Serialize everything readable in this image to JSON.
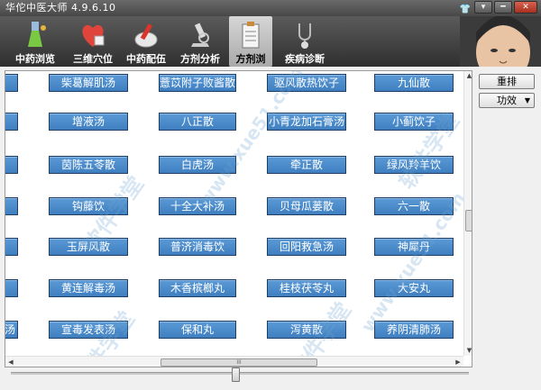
{
  "app": {
    "title": "华佗中医大师 4.9.6.10"
  },
  "window_buttons": {
    "menu": "▾",
    "minimize": "━",
    "close": "✕",
    "skin": "👕"
  },
  "toolbar": {
    "tabs": [
      {
        "label": "中药浏览",
        "icon": "flask-icon"
      },
      {
        "label": "三维穴位",
        "icon": "heart-icon"
      },
      {
        "label": "中药配伍",
        "icon": "mortar-icon"
      },
      {
        "label": "方剂分析",
        "icon": "microscope-icon"
      },
      {
        "label": "方剂浏",
        "icon": "clipboard-icon"
      },
      {
        "label": "疾病诊断",
        "icon": "stethoscope-icon"
      }
    ],
    "active_tab": "方剂浏"
  },
  "grid": {
    "rows": [
      [
        "柴葛解肌汤",
        "薏苡附子败酱散",
        "驱风散热饮子",
        "九仙散"
      ],
      [
        "增液汤",
        "八正散",
        "小青龙加石膏汤",
        "小蓟饮子"
      ],
      [
        "茵陈五苓散",
        "白虎汤",
        "牵正散",
        "绿风羚羊饮"
      ],
      [
        "钩藤饮",
        "十全大补汤",
        "贝母瓜蒌散",
        "六一散"
      ],
      [
        "玉屏风散",
        "普济消毒饮",
        "回阳救急汤",
        "神犀丹"
      ],
      [
        "黄连解毒汤",
        "木香槟榔丸",
        "桂枝茯苓丸",
        "大安丸"
      ],
      [
        "宣毒发表汤",
        "保和丸",
        "泻黄散",
        "养阴清肺汤"
      ]
    ],
    "left_fragments": [
      "汤"
    ]
  },
  "watermarks": [
    "软件学堂",
    "www.xue51.com",
    "51.com"
  ],
  "side": {
    "rearrange": "重排",
    "effect": "功效"
  },
  "scrollbars": {
    "h_thumb_grip": "III"
  },
  "colors": {
    "button_blue": "#4a8bcc",
    "toolbar_dark": "#3a3a3a"
  }
}
